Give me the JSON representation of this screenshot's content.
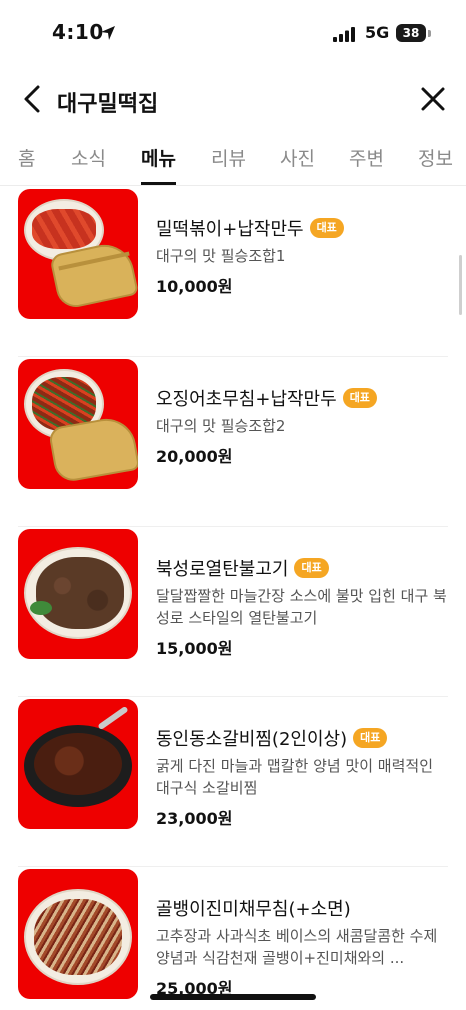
{
  "status_bar": {
    "time": "4:10",
    "network": "5G",
    "battery": "38"
  },
  "header": {
    "title": "대구밀떡집"
  },
  "tabs": [
    {
      "label": "홈",
      "active": false
    },
    {
      "label": "소식",
      "active": false
    },
    {
      "label": "메뉴",
      "active": true
    },
    {
      "label": "리뷰",
      "active": false
    },
    {
      "label": "사진",
      "active": false
    },
    {
      "label": "주변",
      "active": false
    },
    {
      "label": "정보",
      "active": false
    }
  ],
  "menu_items": [
    {
      "name": "밀떡볶이+납작만두",
      "badge": "대표",
      "desc": "대구의 맛 필승조합1",
      "price": "10,000원"
    },
    {
      "name": "오징어초무침+납작만두",
      "badge": "대표",
      "desc": "대구의 맛 필승조합2",
      "price": "20,000원"
    },
    {
      "name": "북성로열탄불고기",
      "badge": "대표",
      "desc": "달달짭짤한 마늘간장 소스에 불맛 입힌 대구 북성로 스타일의 열탄불고기",
      "price": "15,000원"
    },
    {
      "name": "동인동소갈비찜(2인이상)",
      "badge": "대표",
      "desc": "굵게 다진 마늘과 맵칼한 양념 맛이 매력적인 대구식 소갈비찜",
      "price": "23,000원"
    },
    {
      "name": "골뱅이진미채무침(+소면)",
      "badge": "",
      "desc": "고추장과 사과식초 베이스의 새콤달콤한 수제 양념과 식감천재 골뱅이+진미채와의 ...",
      "price": "25,000원"
    }
  ],
  "colors": {
    "accent_badge": "#f5a623",
    "thumb_bg": "#ee0000"
  },
  "icons": {
    "back": "chevron-left-icon",
    "close": "close-icon",
    "location": "location-arrow-icon",
    "signal": "signal-icon"
  }
}
